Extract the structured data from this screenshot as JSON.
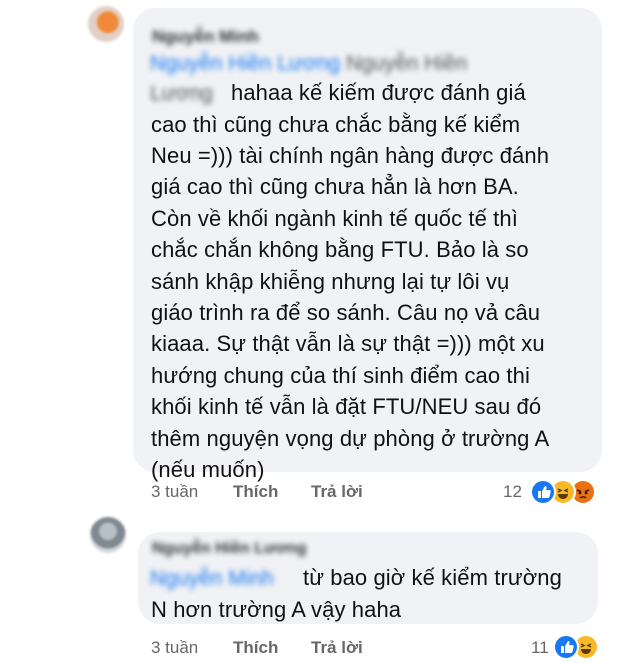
{
  "comments": [
    {
      "author": "Nguyễn Minh",
      "tag_line1": "Nguyễn Hiền Lương",
      "tag_line1_rest": "Nguyễn Hiền",
      "tag_line2": "Lương",
      "text_first": "hahaa kế kiếm được đánh giá",
      "text_rest": "cao thì cũng chưa chắc bằng kế kiểm\nNeu =))) tài chính ngân hàng được đánh\ngiá cao thì cũng chưa hẳn là hơn BA.\nCòn về khối ngành kinh tế quốc tế thì\nchắc chắn không bằng FTU. Bảo là so\nsánh khập khiễng nhưng lại tự lôi vụ\ngiáo trình ra để so sánh. Câu nọ vả câu\nkiaaa. Sự thật vẫn là sự thật =))) một xu\nhướng chung của thí sinh điểm cao thi\nkhối kinh tế vẫn là đặt FTU/NEU sau đó\nthêm nguyện vọng dự phòng ở trường A\n(nếu muốn)",
      "time": "3 tuần",
      "like_label": "Thích",
      "reply_label": "Trả lời",
      "reaction_count": "12",
      "reactions": [
        "like-reaction",
        "haha-reaction",
        "angry-reaction"
      ]
    },
    {
      "author": "Nguyễn Hiền Lương",
      "tag": "Nguyễn Minh",
      "text_first": "từ bao giờ kế kiểm trường",
      "text_rest": "N hơn trường A vậy haha",
      "time": "3 tuần",
      "like_label": "Thích",
      "reply_label": "Trả lời",
      "reaction_count": "11",
      "reactions": [
        "like-reaction",
        "haha-reaction"
      ]
    }
  ],
  "colors": {
    "bubble": "#f0f2f5",
    "text": "#111111",
    "meta": "#65676b",
    "mention": "#1877f2",
    "like": "#1877f2",
    "haha": "#f7b928",
    "angry": "#e9710f"
  }
}
